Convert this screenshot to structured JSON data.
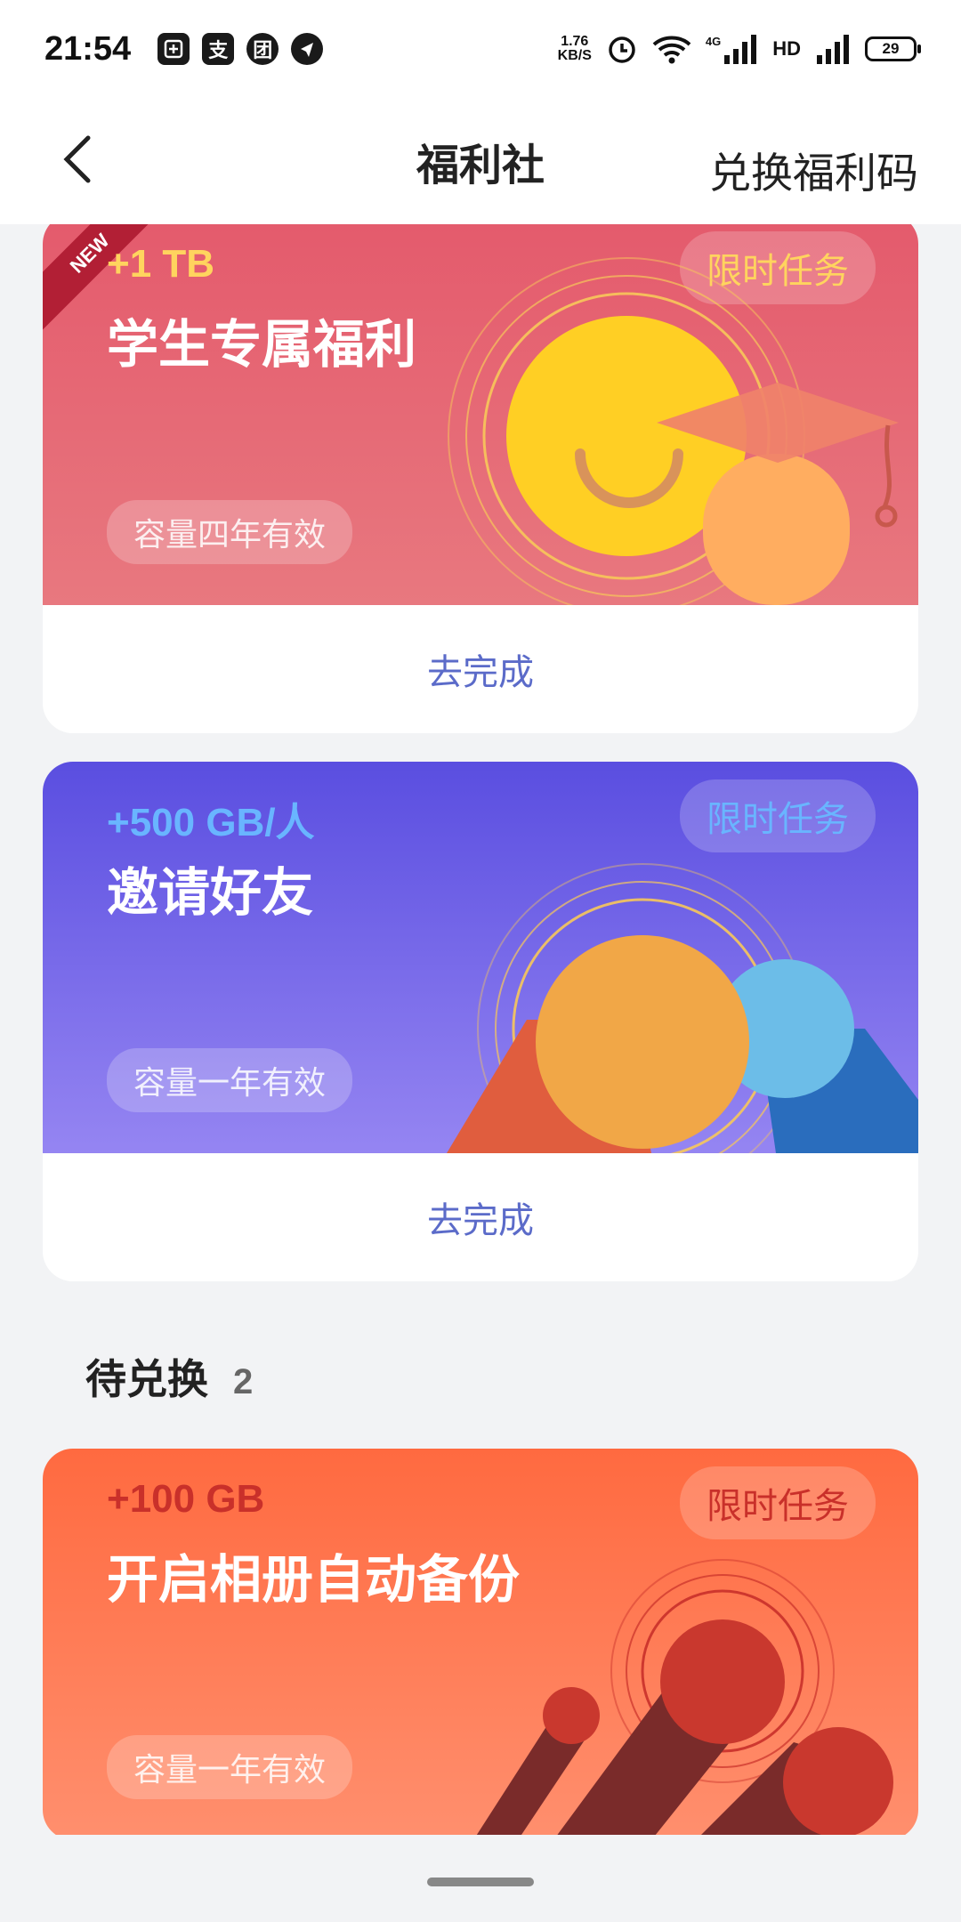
{
  "status_bar": {
    "time": "21:54",
    "app_icons": [
      "支",
      "团"
    ],
    "net_speed_value": "1.76",
    "net_speed_unit": "KB/S",
    "network_label": "4G",
    "hd_label": "HD",
    "battery": "29"
  },
  "nav": {
    "title": "福利社",
    "action": "兑换福利码"
  },
  "cards": [
    {
      "badge": "NEW",
      "amount": "+1 TB",
      "title": "学生专属福利",
      "tag": "限时任务",
      "validity": "容量四年有效",
      "cta": "去完成",
      "colors": {
        "top": "#e45a6c",
        "bottom": "#e87a7e",
        "amount": "#ffd45e",
        "tag_text": "#ffd45e"
      }
    },
    {
      "amount": "+500 GB/人",
      "title": "邀请好友",
      "tag": "限时任务",
      "validity": "容量一年有效",
      "cta": "去完成",
      "colors": {
        "top": "#5a4ee0",
        "bottom": "#8f7df0",
        "amount": "#69b5ff",
        "tag_text": "#69b5ff"
      }
    },
    {
      "amount": "+100 GB",
      "title": "开启相册自动备份",
      "tag": "限时任务",
      "validity": "容量一年有效",
      "colors": {
        "top": "#ff6e45",
        "bottom": "#ff8c6c",
        "amount": "#c9302a",
        "tag_text": "#c9302a"
      }
    }
  ],
  "section": {
    "title": "待兑换",
    "count": "2"
  }
}
